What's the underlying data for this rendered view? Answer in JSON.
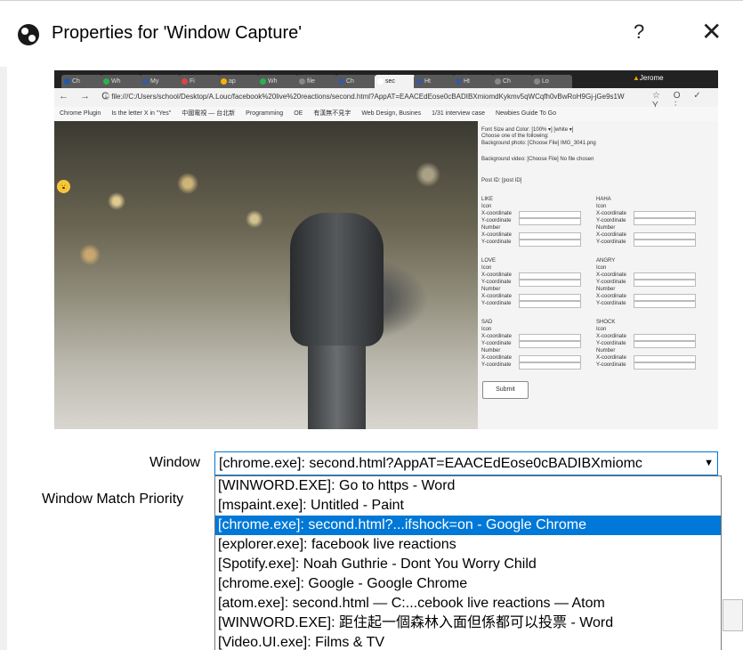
{
  "dialog": {
    "title": "Properties for 'Window Capture'",
    "help_glyph": "?",
    "close_glyph": "✕"
  },
  "browser": {
    "tabs": [
      "Ch",
      "Wh",
      "My",
      "Fi",
      "ap",
      "Wh",
      "file",
      "Ch",
      "sec",
      "Ht",
      "Ht",
      "Ch",
      "Lo"
    ],
    "profile": "Jerome",
    "nav_glyphs": "← → C",
    "url": "ⓘ file:///C:/Users/school/Desktop/A.Louc/facebook%20live%20reactions/second.html?AppAT=EAACEdEose0cBADIBXmiomdKykmv5qWCqfh0vBwRoH9Gj-jGe9s1W",
    "ext_glyphs": "☆ O ✓ Y ⋮",
    "bookmarks": [
      "Chrome Plugin",
      "Is the letter X in \"Yes\"",
      "中國電視 — 台北新",
      "Programming",
      "OE",
      "有漢無不見字",
      "Web Design, Busines",
      "1/31 interview case",
      "Newbies Guide To Go"
    ]
  },
  "form": {
    "line1": "Font Size and Color: [100% ▾] [white ▾]",
    "line2": "Choose one of the following:",
    "line3": "Background photo: [Choose File] IMG_3041.png",
    "line4": "Background video: [Choose File] No file chosen",
    "line5": "Post ID: [post ID]",
    "groups_left": [
      {
        "name": "LIKE",
        "rows": [
          "Icon",
          "X-coordinate",
          "Y-coordinate",
          "Number",
          "X-coordinate",
          "Y-coordinate"
        ]
      },
      {
        "name": "LOVE",
        "rows": [
          "Icon",
          "X-coordinate",
          "Y-coordinate",
          "Number",
          "X-coordinate",
          "Y-coordinate"
        ]
      },
      {
        "name": "SAD",
        "rows": [
          "Icon",
          "X-coordinate",
          "Y-coordinate",
          "Number",
          "X-coordinate",
          "Y-coordinate"
        ]
      }
    ],
    "groups_right": [
      {
        "name": "HAHA",
        "rows": [
          "Icon",
          "X-coordinate",
          "Y-coordinate",
          "Number",
          "X-coordinate",
          "Y-coordinate"
        ]
      },
      {
        "name": "ANGRY",
        "rows": [
          "Icon",
          "X-coordinate",
          "Y-coordinate",
          "Number",
          "X-coordinate",
          "Y-coordinate"
        ]
      },
      {
        "name": "SHOCK",
        "rows": [
          "Icon",
          "X-coordinate",
          "Y-coordinate",
          "Number",
          "X-coordinate",
          "Y-coordinate"
        ]
      }
    ],
    "submit_label": "Submit"
  },
  "fields": {
    "window_label": "Window",
    "priority_label": "Window Match Priority",
    "window_value": "[chrome.exe]: second.html?AppAT=EAACEdEose0cBADIBXmiomc",
    "dropdown_arrow": "▼",
    "options": [
      "[WINWORD.EXE]: Go to https - Word",
      "[mspaint.exe]: Untitled - Paint",
      "[chrome.exe]: second.html?...ifshock=on - Google Chrome",
      "[explorer.exe]: facebook live reactions",
      "[Spotify.exe]: Noah Guthrie - Dont You Worry Child",
      "[chrome.exe]: Google - Google Chrome",
      "[atom.exe]: second.html — C:...cebook live reactions — Atom",
      "[WINWORD.EXE]: 距住起一個森林入面但係都可以投票 - Word",
      "[Video.UI.exe]: Films & TV"
    ],
    "selected_index": 2
  }
}
